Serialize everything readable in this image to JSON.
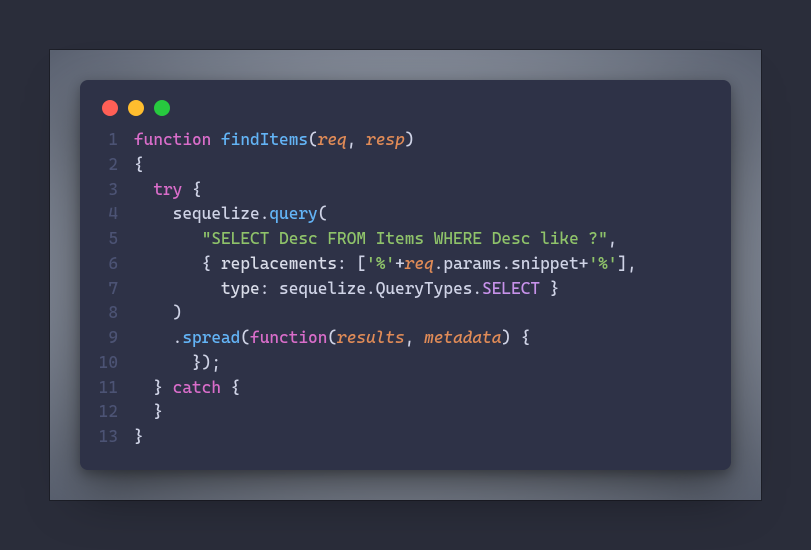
{
  "window": {
    "buttons": [
      "close",
      "minimize",
      "zoom"
    ]
  },
  "code": {
    "lines": [
      {
        "n": "1",
        "tokens": [
          {
            "c": "kw",
            "t": "function"
          },
          {
            "c": "punct",
            "t": " "
          },
          {
            "c": "fn",
            "t": "findItems"
          },
          {
            "c": "punct",
            "t": "("
          },
          {
            "c": "param",
            "t": "req"
          },
          {
            "c": "punct",
            "t": ", "
          },
          {
            "c": "param",
            "t": "resp"
          },
          {
            "c": "punct",
            "t": ")"
          }
        ]
      },
      {
        "n": "2",
        "tokens": [
          {
            "c": "punct",
            "t": "{"
          }
        ]
      },
      {
        "n": "3",
        "tokens": [
          {
            "c": "punct",
            "t": "  "
          },
          {
            "c": "kw",
            "t": "try"
          },
          {
            "c": "punct",
            "t": " {"
          }
        ]
      },
      {
        "n": "4",
        "tokens": [
          {
            "c": "punct",
            "t": "    "
          },
          {
            "c": "obj",
            "t": "sequelize"
          },
          {
            "c": "punct",
            "t": "."
          },
          {
            "c": "method",
            "t": "query"
          },
          {
            "c": "punct",
            "t": "("
          }
        ]
      },
      {
        "n": "5",
        "tokens": [
          {
            "c": "punct",
            "t": "       "
          },
          {
            "c": "str",
            "t": "\"SELECT Desc FROM Items WHERE Desc like ?\""
          },
          {
            "c": "punct",
            "t": ","
          }
        ]
      },
      {
        "n": "6",
        "tokens": [
          {
            "c": "punct",
            "t": "       { "
          },
          {
            "c": "prop",
            "t": "replacements"
          },
          {
            "c": "punct",
            "t": ": ["
          },
          {
            "c": "str",
            "t": "'%'"
          },
          {
            "c": "punct",
            "t": "+"
          },
          {
            "c": "param",
            "t": "req"
          },
          {
            "c": "punct",
            "t": "."
          },
          {
            "c": "obj",
            "t": "params"
          },
          {
            "c": "punct",
            "t": "."
          },
          {
            "c": "obj",
            "t": "snippet"
          },
          {
            "c": "punct",
            "t": "+"
          },
          {
            "c": "str",
            "t": "'%'"
          },
          {
            "c": "punct",
            "t": "],"
          }
        ]
      },
      {
        "n": "7",
        "tokens": [
          {
            "c": "punct",
            "t": "         "
          },
          {
            "c": "prop",
            "t": "type"
          },
          {
            "c": "punct",
            "t": ": "
          },
          {
            "c": "obj",
            "t": "sequelize"
          },
          {
            "c": "punct",
            "t": "."
          },
          {
            "c": "obj",
            "t": "QueryTypes"
          },
          {
            "c": "punct",
            "t": "."
          },
          {
            "c": "const",
            "t": "SELECT"
          },
          {
            "c": "punct",
            "t": " }"
          }
        ]
      },
      {
        "n": "8",
        "tokens": [
          {
            "c": "punct",
            "t": "    )"
          }
        ]
      },
      {
        "n": "9",
        "tokens": [
          {
            "c": "punct",
            "t": "    ."
          },
          {
            "c": "method",
            "t": "spread"
          },
          {
            "c": "punct",
            "t": "("
          },
          {
            "c": "kw",
            "t": "function"
          },
          {
            "c": "punct",
            "t": "("
          },
          {
            "c": "param",
            "t": "results"
          },
          {
            "c": "punct",
            "t": ", "
          },
          {
            "c": "param",
            "t": "metadata"
          },
          {
            "c": "punct",
            "t": ") {"
          }
        ]
      },
      {
        "n": "10",
        "tokens": [
          {
            "c": "punct",
            "t": "      });"
          }
        ]
      },
      {
        "n": "11",
        "tokens": [
          {
            "c": "punct",
            "t": "  } "
          },
          {
            "c": "kw",
            "t": "catch"
          },
          {
            "c": "punct",
            "t": " {"
          }
        ]
      },
      {
        "n": "12",
        "tokens": [
          {
            "c": "punct",
            "t": "  }"
          }
        ]
      },
      {
        "n": "13",
        "tokens": [
          {
            "c": "punct",
            "t": "}"
          }
        ]
      }
    ]
  }
}
